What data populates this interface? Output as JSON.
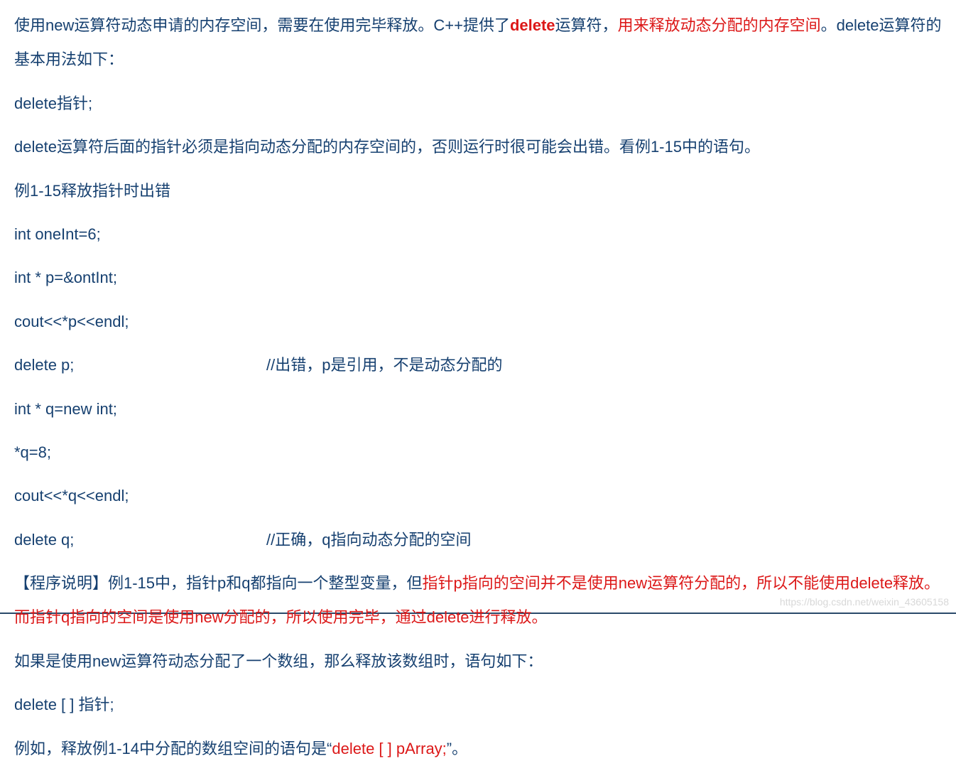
{
  "p1": {
    "s1": "使用new运算符动态申请的内存空间，需要在使用完毕释放。C++提供了",
    "s2": "delete",
    "s3": "运算符，",
    "s4": "用来释放动态分配的内存空间",
    "s5": "。delete运算符的基本用法如下："
  },
  "p2": "delete指针;",
  "p3": "delete运算符后面的指针必须是指向动态分配的内存空间的，否则运行时很可能会出错。看例1-15中的语句。",
  "p4": "例1-15释放指针时出错",
  "p5": "int oneInt=6;",
  "p6": "int * p=&ontInt;",
  "p7": "cout<<*p<<endl;",
  "p8": {
    "code": "delete  p;",
    "comment": "//出错，p是引用，不是动态分配的"
  },
  "p9": "int * q=new int;",
  "p10": "*q=8;",
  "p11": "cout<<*q<<endl;",
  "p12": {
    "code": "delete q;",
    "comment": "//正确，q指向动态分配的空间"
  },
  "p13": {
    "s1": "【程序说明】例1-15中，指针p和q都指向一个整型变量，但",
    "s2": "指针p指向的空间并不是使用new运算符分配的，所以不能使用delete释放。而指针q指向的空间是使用new分配的，所以使用完毕，通过delete进行释放。"
  },
  "p14": "如果是使用new运算符动态分配了一个数组，那么释放该数组时，语句如下：",
  "p15": "delete [ ] 指针;",
  "p16": {
    "s1": "例如，释放例1-14中分配的数组空间的语句是“",
    "s2": "delete [ ] pArray;",
    "s3": "”。"
  },
  "watermark": "https://blog.csdn.net/weixin_43605158"
}
